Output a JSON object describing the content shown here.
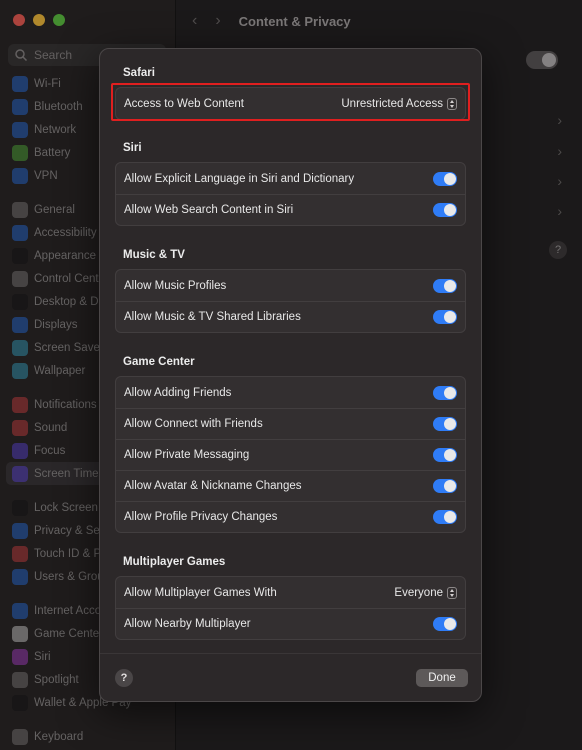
{
  "window": {
    "title": "Content & Privacy",
    "search_placeholder": "Search"
  },
  "sidebar": {
    "items": [
      {
        "label": "Wi-Fi",
        "color": "#2f7cf6"
      },
      {
        "label": "Bluetooth",
        "color": "#2f7cf6"
      },
      {
        "label": "Network",
        "color": "#2f7cf6"
      },
      {
        "label": "Battery",
        "color": "#5fc443"
      },
      {
        "label": "VPN",
        "color": "#2f7cf6"
      },
      {
        "label": "General",
        "color": "#8e8a8b"
      },
      {
        "label": "Accessibility",
        "color": "#2f7cf6"
      },
      {
        "label": "Appearance",
        "color": "#1c1a1b"
      },
      {
        "label": "Control Centre",
        "color": "#8e8a8b"
      },
      {
        "label": "Desktop & Dock",
        "color": "#1c1a1b"
      },
      {
        "label": "Displays",
        "color": "#2f7cf6"
      },
      {
        "label": "Screen Saver",
        "color": "#3fb6d8"
      },
      {
        "label": "Wallpaper",
        "color": "#3fb6d8"
      },
      {
        "label": "Notifications",
        "color": "#e5484d"
      },
      {
        "label": "Sound",
        "color": "#e5484d"
      },
      {
        "label": "Focus",
        "color": "#6a4ef0"
      },
      {
        "label": "Screen Time",
        "color": "#6a4ef0"
      },
      {
        "label": "Lock Screen",
        "color": "#1c1a1b"
      },
      {
        "label": "Privacy & Security",
        "color": "#2f7cf6"
      },
      {
        "label": "Touch ID & Password",
        "color": "#e5484d"
      },
      {
        "label": "Users & Groups",
        "color": "#2f7cf6"
      },
      {
        "label": "Internet Accounts",
        "color": "#2f7cf6"
      },
      {
        "label": "Game Center",
        "color": "#e9e9e9"
      },
      {
        "label": "Siri",
        "color": "#c04be0"
      },
      {
        "label": "Spotlight",
        "color": "#8e8a8b"
      },
      {
        "label": "Wallet & Apple Pay",
        "color": "#1c1a1b"
      },
      {
        "label": "Keyboard",
        "color": "#8e8a8b"
      }
    ]
  },
  "sheet": {
    "sections": {
      "safari": {
        "title": "Safari",
        "rows": [
          {
            "label": "Access to Web Content",
            "value": "Unrestricted Access"
          }
        ]
      },
      "siri": {
        "title": "Siri",
        "rows": [
          {
            "label": "Allow Explicit Language in Siri and Dictionary"
          },
          {
            "label": "Allow Web Search Content in Siri"
          }
        ]
      },
      "music": {
        "title": "Music & TV",
        "rows": [
          {
            "label": "Allow Music Profiles"
          },
          {
            "label": "Allow Music & TV Shared Libraries"
          }
        ]
      },
      "gamecenter": {
        "title": "Game Center",
        "rows": [
          {
            "label": "Allow Adding Friends"
          },
          {
            "label": "Allow Connect with Friends"
          },
          {
            "label": "Allow Private Messaging"
          },
          {
            "label": "Allow Avatar & Nickname Changes"
          },
          {
            "label": "Allow Profile Privacy Changes"
          }
        ]
      },
      "multiplayer": {
        "title": "Multiplayer Games",
        "rows": [
          {
            "label": "Allow Multiplayer Games With",
            "value": "Everyone"
          },
          {
            "label": "Allow Nearby Multiplayer"
          }
        ]
      }
    },
    "footer": {
      "help": "?",
      "done": "Done"
    }
  },
  "colors": {
    "accent": "#2f7cf6",
    "highlight": "#e01f1f"
  }
}
